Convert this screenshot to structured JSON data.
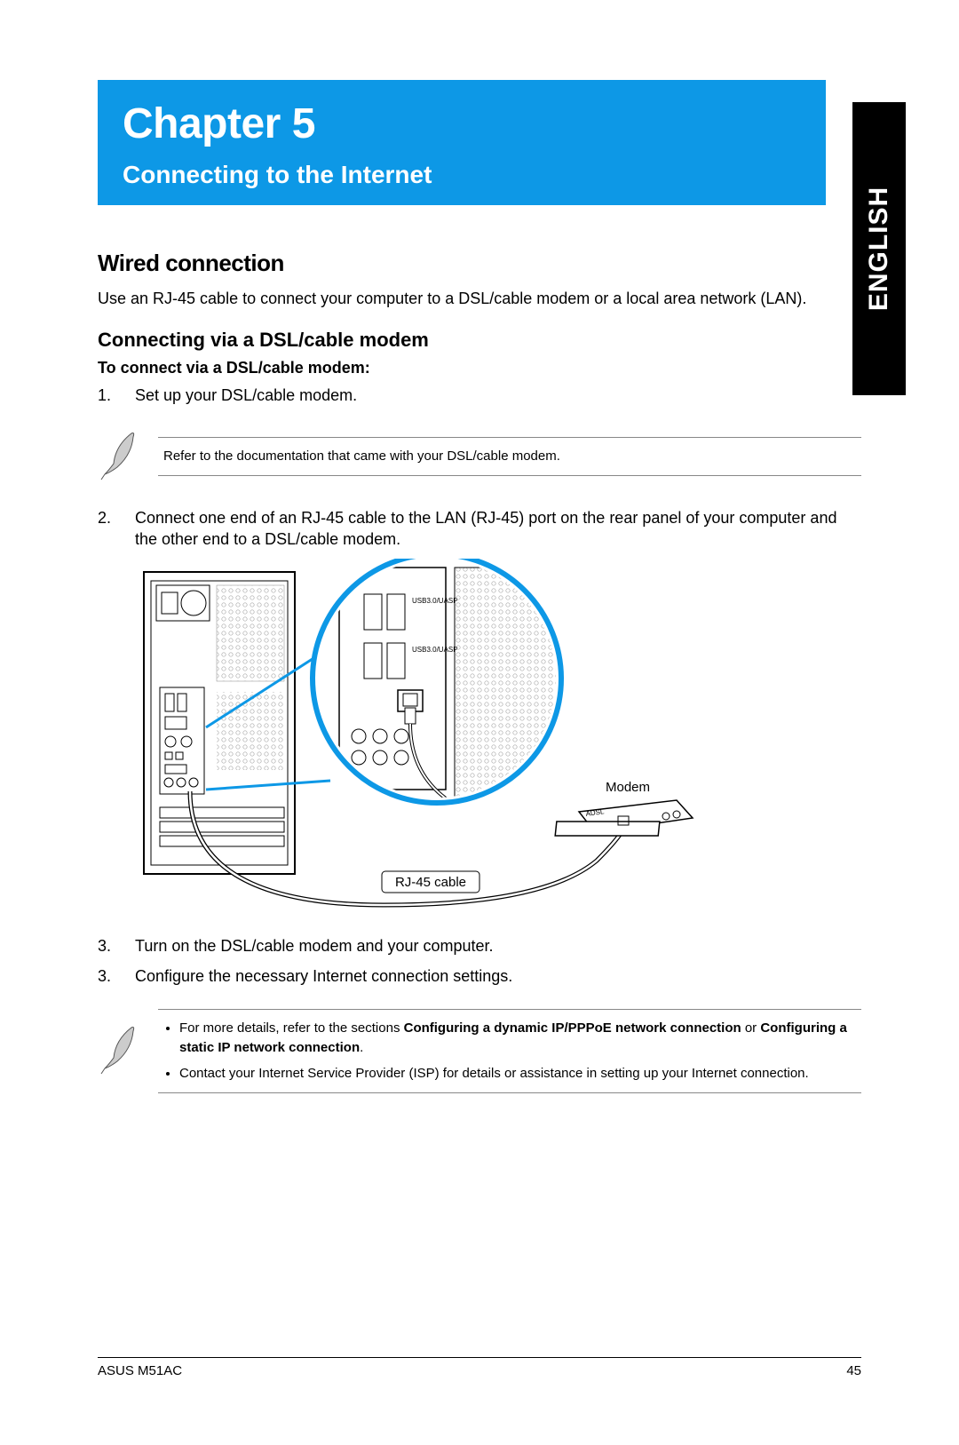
{
  "lang": "ENGLISH",
  "banner": {
    "chapter": "Chapter 5",
    "subtitle": "Connecting to the Internet"
  },
  "section": "Wired connection",
  "intro": "Use an RJ-45 cable to connect your computer to a DSL/cable modem or a local area network (LAN).",
  "sub": "Connecting via a DSL/cable modem",
  "subsub": "To connect via a DSL/cable modem:",
  "steps": {
    "s1_num": "1.",
    "s1_txt": "Set up your DSL/cable modem.",
    "s2_num": "2.",
    "s2_txt": "Connect one end of an RJ-45 cable to the LAN (RJ-45) port on the rear panel of your computer and the other end to a DSL/cable modem.",
    "s3_num": "3.",
    "s3_txt": "Turn on the DSL/cable modem and your computer.",
    "s4_num": "3.",
    "s4_txt": "Configure the necessary Internet connection settings."
  },
  "note1": "Refer to the documentation that came with your DSL/cable modem.",
  "diagram": {
    "modem_label": "Modem",
    "cable_label": "RJ-45 cable",
    "port_label_1": "USB3.0/UASP",
    "port_label_2": "USB3.0/UASP",
    "modem_text": "ADSL"
  },
  "note2": {
    "b1_a": "For more details, refer to the sections ",
    "b1_b": "Configuring a dynamic IP/PPPoE network connection",
    "b1_c": " or ",
    "b1_d": "Configuring a static IP network connection",
    "b1_e": ".",
    "b2": "Contact your Internet Service Provider (ISP) for details or assistance in setting up your Internet connection."
  },
  "footer": {
    "left": "ASUS M51AC",
    "right": "45"
  }
}
